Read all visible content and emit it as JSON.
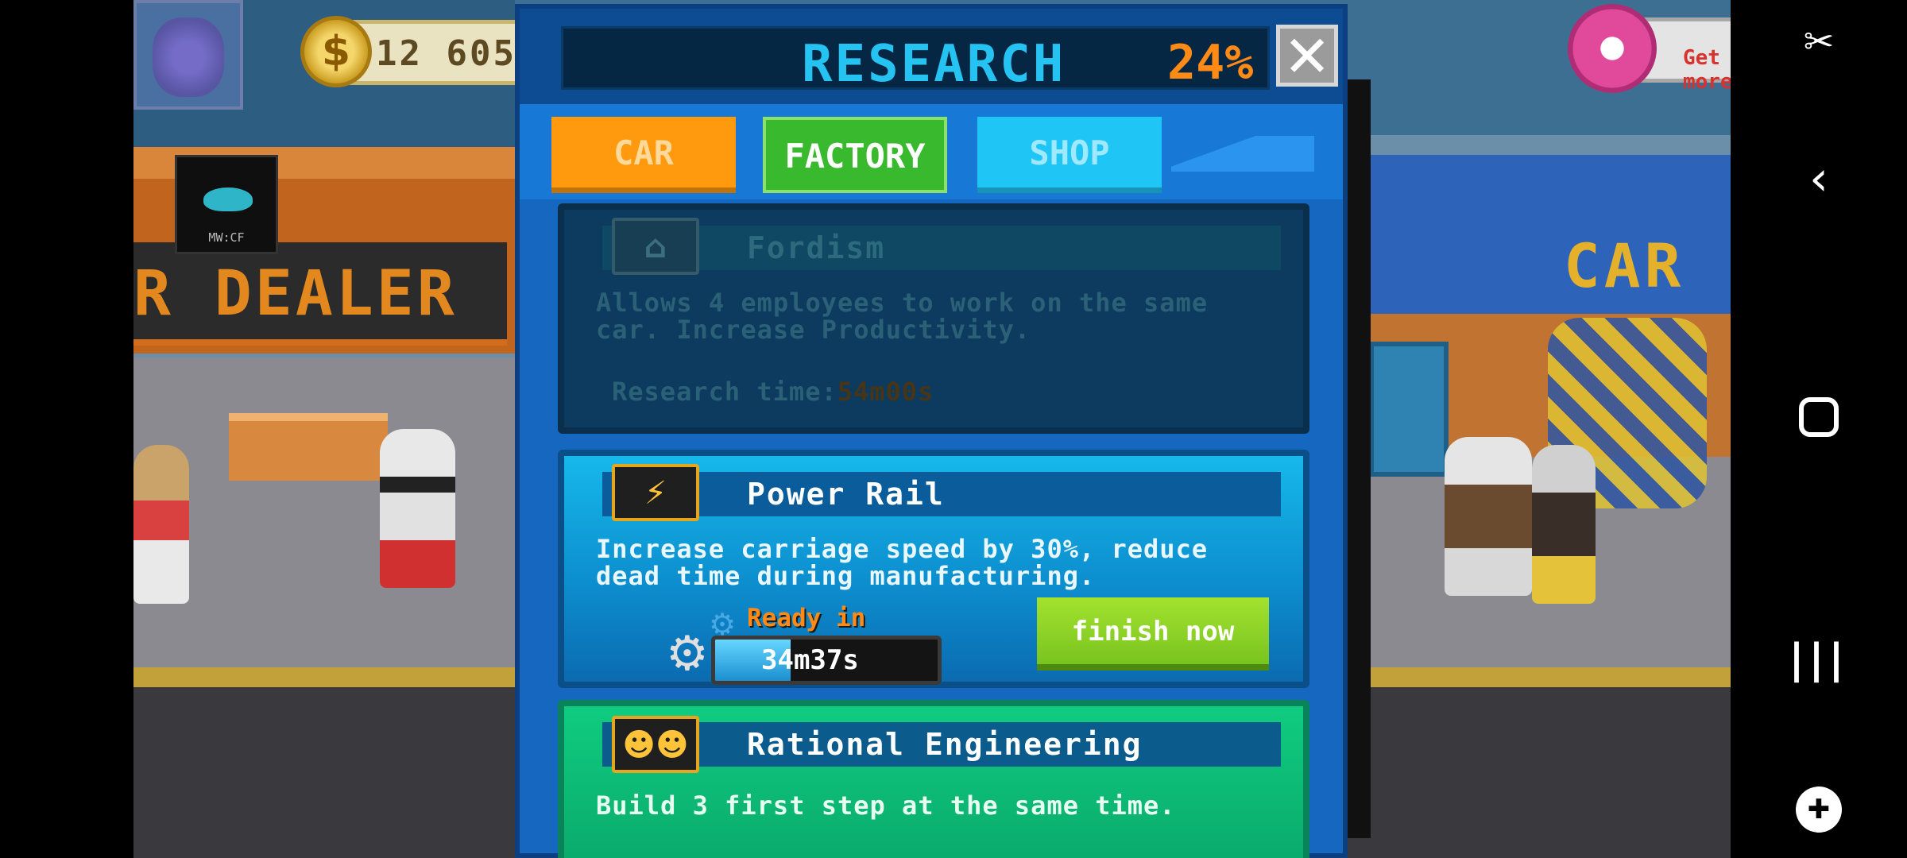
{
  "hud": {
    "coins": "12 605",
    "coin_symbol": "$",
    "get_more_label": "Get more"
  },
  "scene": {
    "dealer_sign": "R DEALER",
    "ufo_label": "MW:CF",
    "right_sign": "CAR"
  },
  "research": {
    "title": "RESEARCH",
    "progress_percent": "24%",
    "close_symbol": "✕",
    "tabs": [
      {
        "label": "CAR",
        "color": "#ff9a0e",
        "active": false
      },
      {
        "label": "FACTORY",
        "color": "#39b92e",
        "active": true
      },
      {
        "label": "SHOP",
        "color": "#1fc5f5",
        "active": false
      }
    ],
    "items": [
      {
        "name": "Fordism",
        "icon": "employees-icon",
        "description": "Allows 4 employees to work on the same car. Increase Productivity.",
        "time_label": "Research time:",
        "time_value": "54m00s",
        "state": "locked"
      },
      {
        "name": "Power Rail",
        "icon": "power-rail-icon",
        "description": "Increase carriage speed by 30%, reduce dead time during manufacturing.",
        "ready_label": "Ready in",
        "remaining": "34m37s",
        "progress": 0.34,
        "button_label": "finish now",
        "state": "in-progress"
      },
      {
        "name": "Rational Engineering",
        "icon": "workers-icon",
        "description": "Build 3 first step at the same time.",
        "state": "available"
      }
    ]
  },
  "colors": {
    "accent_orange": "#ff8a15",
    "title_cyan": "#25c3f2",
    "finish_green": "#8ad427"
  }
}
